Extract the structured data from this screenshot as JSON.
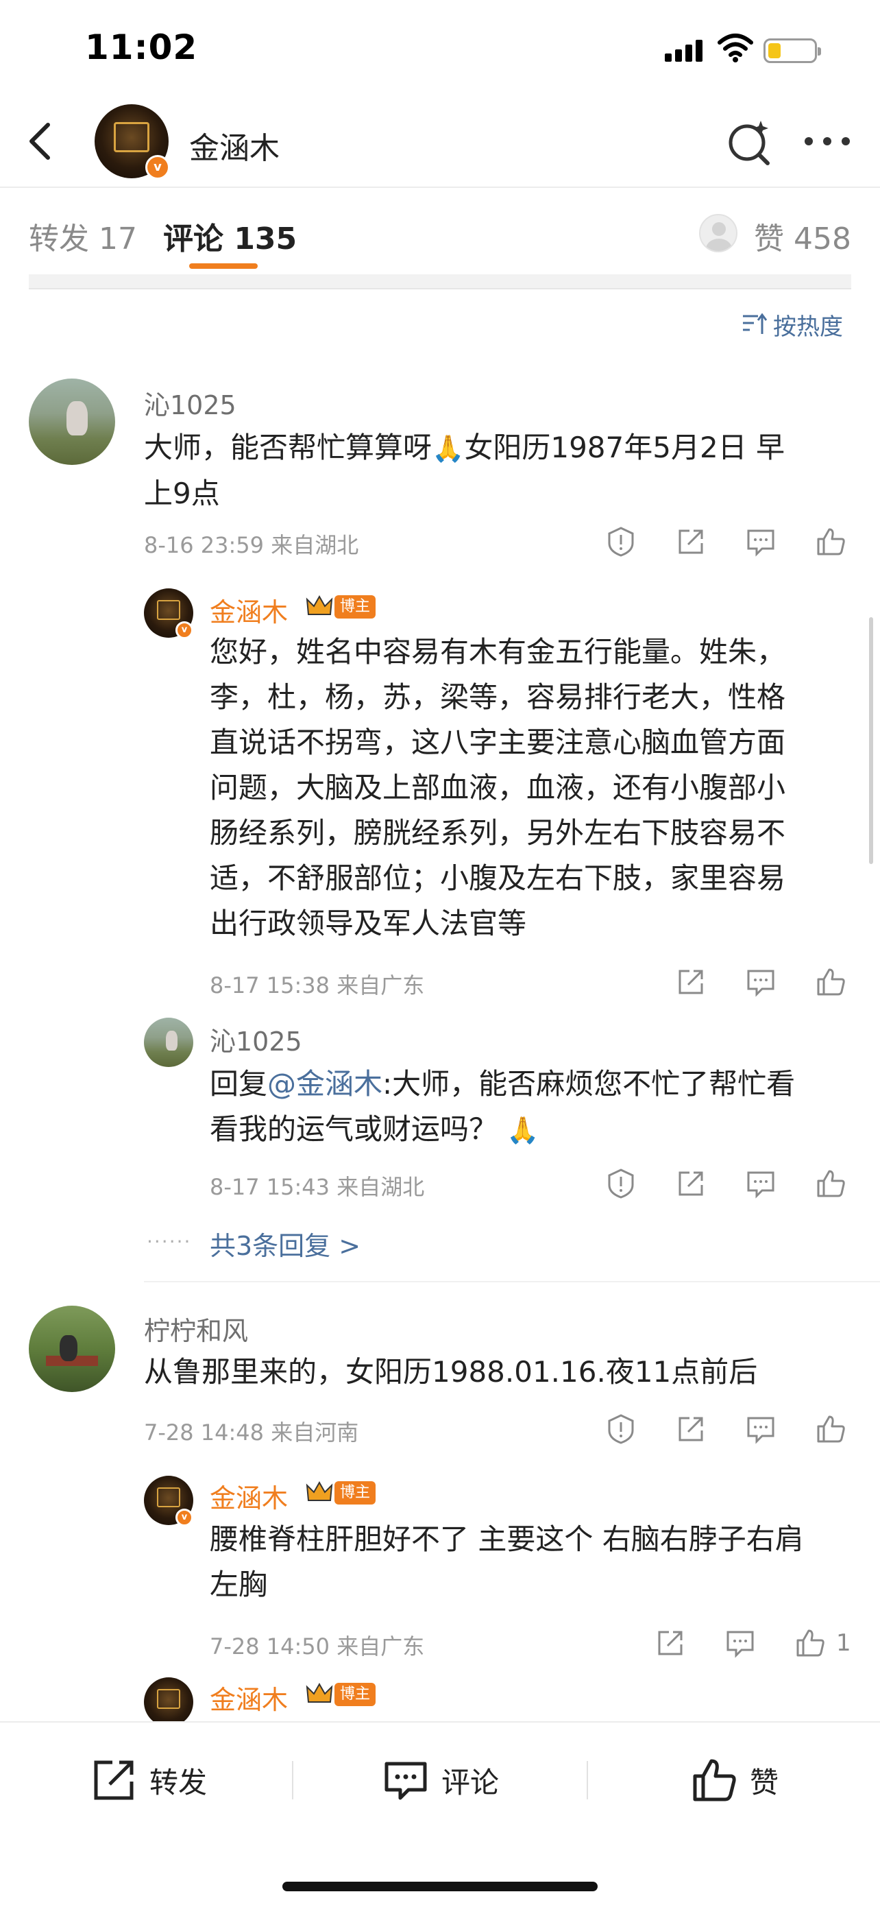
{
  "status_bar": {
    "time": "11:02"
  },
  "header": {
    "title": "金涵木",
    "back_icon": "chevron-left-icon",
    "search_icon": "search-sparkle-icon",
    "more_icon": "more-dots-icon"
  },
  "tabs": {
    "repost": "转发 17",
    "comments": "评论 135",
    "likes": "赞 458",
    "active": "comments",
    "accent_color": "#f07e1e"
  },
  "sort": {
    "label": "按热度"
  },
  "comments": [
    {
      "user": "沁1025",
      "text_line1": "大师，能否帮忙算算呀",
      "emoji": "🙏",
      "text_line1b": "女阳历1987年5月2日 早",
      "text_line2": "上9点",
      "meta": "8-16 23:59  来自湖北",
      "replies": [
        {
          "user": "金涵木",
          "badge": "博主",
          "lines": [
            "您好，姓名中容易有木有金五行能量。姓朱，",
            "李，杜，杨，苏，梁等，容易排行老大，性格",
            "直说话不拐弯，这八字主要注意心脑血管方面",
            "问题，大脑及上部血液，血液，还有小腹部小",
            "肠经系列，膀胱经系列，另外左右下肢容易不",
            "适，不舒服部位；小腹及左右下肢，家里容易",
            "出行政领导及军人法官等"
          ],
          "meta": "8-17 15:38  来自广东"
        },
        {
          "user": "沁1025",
          "prefix": "回复",
          "mention": "@金涵木",
          "line1": ":大师，能否麻烦您不忙了帮忙看",
          "line2": "看我的运气或财运吗？",
          "emoji": "🙏",
          "meta": "8-17 15:43  来自湖北"
        }
      ],
      "more_replies": "共3条回复 >"
    },
    {
      "user": "柠柠和风",
      "text": "从鲁那里来的，女阳历1988.01.16.夜11点前后",
      "meta": "7-28 14:48  来自河南",
      "replies": [
        {
          "user": "金涵木",
          "badge": "博主",
          "lines": [
            "腰椎脊柱肝胆好不了 主要这个 右脑右脖子右肩",
            "左胸"
          ],
          "meta": "7-28 14:50  来自广东",
          "like_count": "1"
        },
        {
          "user": "金涵木",
          "badge": "博主"
        }
      ]
    }
  ],
  "bottom_bar": {
    "repost": "转发",
    "comment": "评论",
    "like": "赞"
  },
  "icons": {
    "report": "report-shield-icon",
    "share": "share-out-icon",
    "comment": "comment-bubble-icon",
    "like": "thumbs-up-icon",
    "verified": "verified-v-icon",
    "crown": "crown-icon"
  }
}
